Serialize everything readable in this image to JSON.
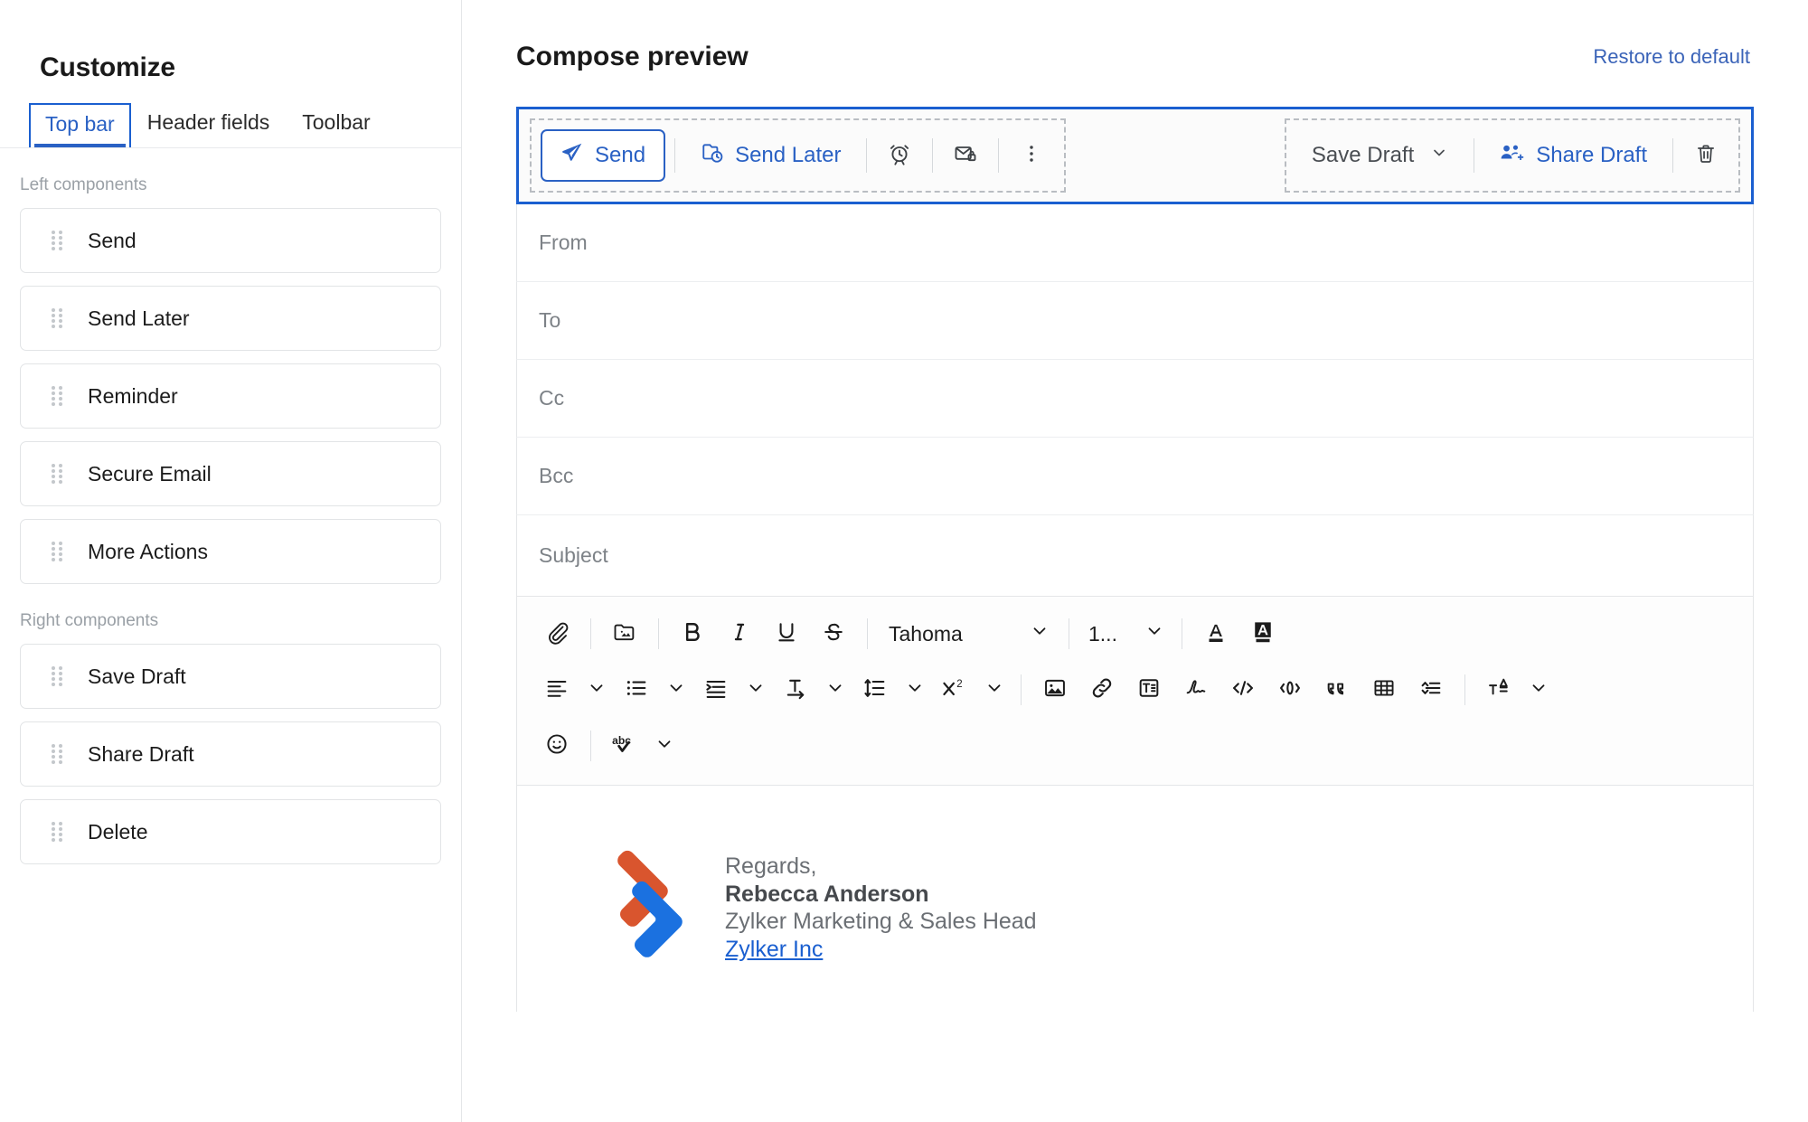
{
  "sidebar": {
    "title": "Customize",
    "tabs": [
      {
        "label": "Top bar",
        "active": true
      },
      {
        "label": "Header fields",
        "active": false
      },
      {
        "label": "Toolbar",
        "active": false
      }
    ],
    "left_group_label": "Left components",
    "left_components": [
      {
        "label": "Send",
        "icon": "drag-handle-icon"
      },
      {
        "label": "Send Later",
        "icon": "drag-handle-icon"
      },
      {
        "label": "Reminder",
        "icon": "drag-handle-icon"
      },
      {
        "label": "Secure Email",
        "icon": "drag-handle-icon"
      },
      {
        "label": "More Actions",
        "icon": "drag-handle-icon"
      }
    ],
    "right_group_label": "Right components",
    "right_components": [
      {
        "label": "Save Draft",
        "icon": "drag-handle-icon"
      },
      {
        "label": "Share Draft",
        "icon": "drag-handle-icon"
      },
      {
        "label": "Delete",
        "icon": "drag-handle-icon"
      }
    ]
  },
  "header": {
    "title": "Compose preview",
    "restore_label": "Restore to default"
  },
  "topbar": {
    "left": {
      "send_label": "Send",
      "send_later_label": "Send Later",
      "reminder_icon": "alarm-clock-icon",
      "secure_email_icon": "secure-email-icon",
      "more_actions_icon": "more-vertical-icon"
    },
    "right": {
      "save_draft_label": "Save Draft",
      "save_draft_chevron": "chevron-down-icon",
      "share_draft_label": "Share Draft",
      "delete_icon": "trash-icon"
    }
  },
  "fields": [
    {
      "label": "From"
    },
    {
      "label": "To"
    },
    {
      "label": "Cc"
    },
    {
      "label": "Bcc"
    },
    {
      "label": "Subject"
    }
  ],
  "editor": {
    "font_family_value": "Tahoma",
    "font_size_value": "1...",
    "row1_icons": [
      "attachment-icon",
      "insert-image-from-cloud-icon",
      "bold-icon",
      "italic-icon",
      "underline-icon",
      "strikethrough-icon",
      "text-color-icon",
      "highlight-color-icon"
    ],
    "row2_icons": [
      "align-left-icon",
      "bullet-list-icon",
      "indent-icon",
      "text-direction-icon",
      "line-spacing-icon",
      "superscript-icon",
      "insert-image-icon",
      "insert-link-icon",
      "insert-template-icon",
      "signature-icon",
      "code-icon",
      "code-snippet-icon",
      "blockquote-icon",
      "insert-table-icon",
      "collapse-text-icon",
      "clear-formatting-icon"
    ],
    "row3_icons": [
      "emoji-icon",
      "spell-check-icon"
    ]
  },
  "signature": {
    "greeting": "Regards,",
    "name": "Rebecca Anderson",
    "role": "Zylker Marketing & Sales Head",
    "company_link": "Zylker Inc",
    "logo_name": "zylker-logo"
  },
  "colors": {
    "accent_blue": "#2a61c4",
    "border_blue": "#1a5fd0",
    "link_blue": "#3a63b8",
    "logo_orange": "#d9552e",
    "logo_blue": "#1b71e0"
  }
}
